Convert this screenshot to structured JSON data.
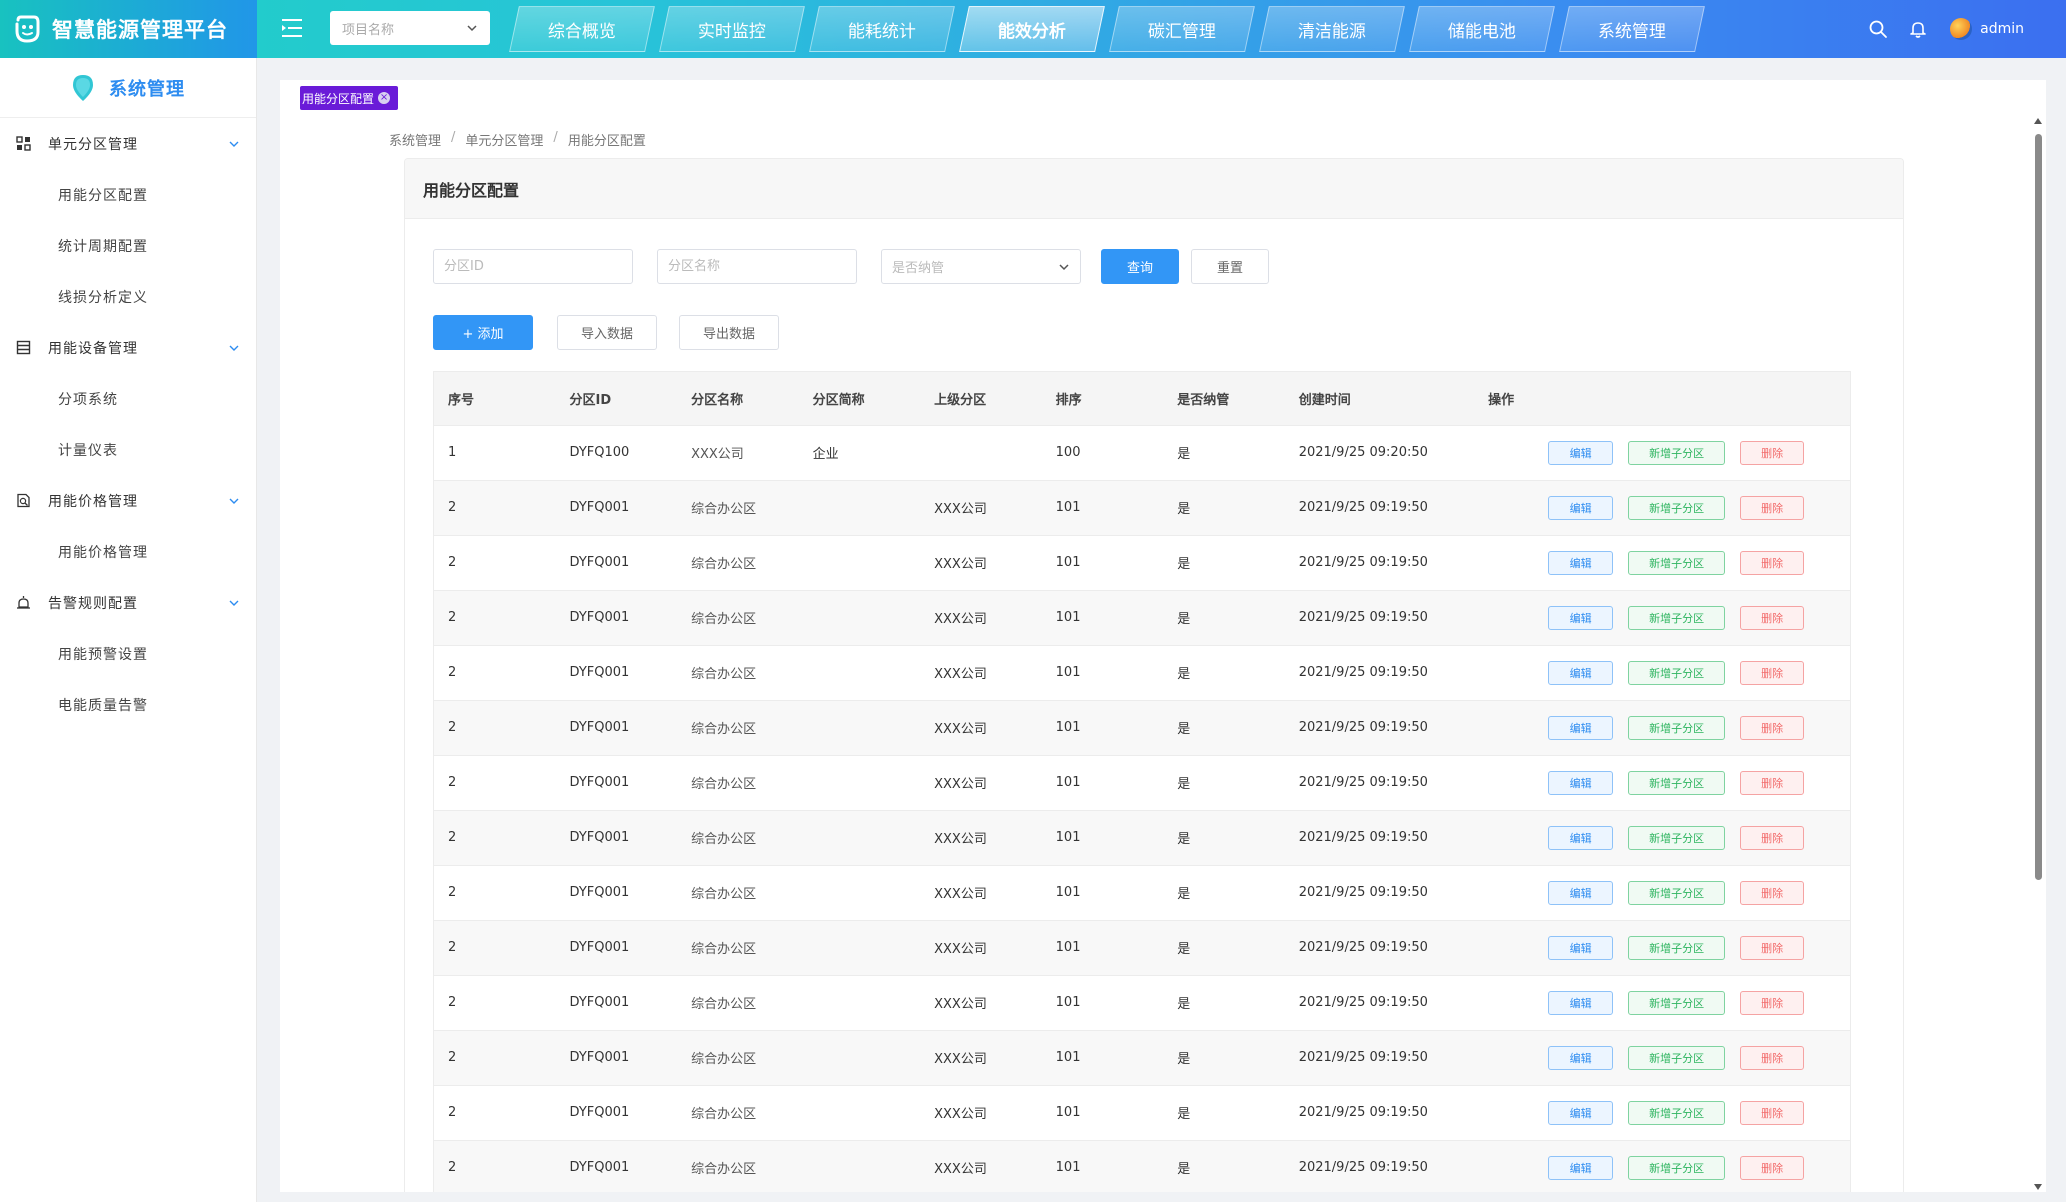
{
  "app": {
    "title": "智慧能源管理平台",
    "project_placeholder": "项目名称",
    "username": "admin"
  },
  "nav": {
    "tabs": [
      {
        "label": "综合概览",
        "active": false
      },
      {
        "label": "实时监控",
        "active": false
      },
      {
        "label": "能耗统计",
        "active": false
      },
      {
        "label": "能效分析",
        "active": true
      },
      {
        "label": "碳汇管理",
        "active": false
      },
      {
        "label": "清洁能源",
        "active": false
      },
      {
        "label": "储能电池",
        "active": false
      },
      {
        "label": "系统管理",
        "active": false
      }
    ]
  },
  "sidebar": {
    "title": "系统管理",
    "groups": [
      {
        "label": "单元分区管理",
        "icon": "grid-icon",
        "items": [
          "用能分区配置",
          "统计周期配置",
          "线损分析定义"
        ]
      },
      {
        "label": "用能设备管理",
        "icon": "list-icon",
        "items": [
          "分项系统",
          "计量仪表"
        ]
      },
      {
        "label": "用能价格管理",
        "icon": "price-icon",
        "items": [
          "用能价格管理"
        ]
      },
      {
        "label": "告警规则配置",
        "icon": "alarm-icon",
        "items": [
          "用能预警设置",
          "电能质量告警"
        ]
      }
    ]
  },
  "tag": {
    "label": "用能分区配置"
  },
  "breadcrumb": {
    "items": [
      "系统管理",
      "单元分区管理",
      "用能分区配置"
    ]
  },
  "card": {
    "title": "用能分区配置"
  },
  "filters": {
    "id_placeholder": "分区ID",
    "name_placeholder": "分区名称",
    "managed_placeholder": "是否纳管",
    "query_label": "查询",
    "reset_label": "重置"
  },
  "actions": {
    "add_label": "+ 添加",
    "import_label": "导入数据",
    "export_label": "导出数据"
  },
  "table": {
    "headers": [
      "序号",
      "分区ID",
      "分区名称",
      "分区简称",
      "上级分区",
      "排序",
      "是否纳管",
      "创建时间",
      "操作"
    ],
    "op_labels": {
      "edit": "编辑",
      "add_child": "新增子分区",
      "delete": "删除"
    },
    "rows": [
      [
        "1",
        "DYFQ100",
        "XXX公司",
        "企业",
        "",
        "100",
        "是",
        "2021/9/25 09:20:50"
      ],
      [
        "2",
        "DYFQ001",
        "综合办公区",
        "",
        "XXX公司",
        "101",
        "是",
        "2021/9/25 09:19:50"
      ],
      [
        "2",
        "DYFQ001",
        "综合办公区",
        "",
        "XXX公司",
        "101",
        "是",
        "2021/9/25 09:19:50"
      ],
      [
        "2",
        "DYFQ001",
        "综合办公区",
        "",
        "XXX公司",
        "101",
        "是",
        "2021/9/25 09:19:50"
      ],
      [
        "2",
        "DYFQ001",
        "综合办公区",
        "",
        "XXX公司",
        "101",
        "是",
        "2021/9/25 09:19:50"
      ],
      [
        "2",
        "DYFQ001",
        "综合办公区",
        "",
        "XXX公司",
        "101",
        "是",
        "2021/9/25 09:19:50"
      ],
      [
        "2",
        "DYFQ001",
        "综合办公区",
        "",
        "XXX公司",
        "101",
        "是",
        "2021/9/25 09:19:50"
      ],
      [
        "2",
        "DYFQ001",
        "综合办公区",
        "",
        "XXX公司",
        "101",
        "是",
        "2021/9/25 09:19:50"
      ],
      [
        "2",
        "DYFQ001",
        "综合办公区",
        "",
        "XXX公司",
        "101",
        "是",
        "2021/9/25 09:19:50"
      ],
      [
        "2",
        "DYFQ001",
        "综合办公区",
        "",
        "XXX公司",
        "101",
        "是",
        "2021/9/25 09:19:50"
      ],
      [
        "2",
        "DYFQ001",
        "综合办公区",
        "",
        "XXX公司",
        "101",
        "是",
        "2021/9/25 09:19:50"
      ],
      [
        "2",
        "DYFQ001",
        "综合办公区",
        "",
        "XXX公司",
        "101",
        "是",
        "2021/9/25 09:19:50"
      ],
      [
        "2",
        "DYFQ001",
        "综合办公区",
        "",
        "XXX公司",
        "101",
        "是",
        "2021/9/25 09:19:50"
      ],
      [
        "2",
        "DYFQ001",
        "综合办公区",
        "",
        "XXX公司",
        "101",
        "是",
        "2021/9/25 09:19:50"
      ]
    ]
  },
  "colors": {
    "primary": "#3296f6",
    "success": "#2fb560",
    "danger": "#f26b6b",
    "active_tab_accent": "#ffffff"
  }
}
